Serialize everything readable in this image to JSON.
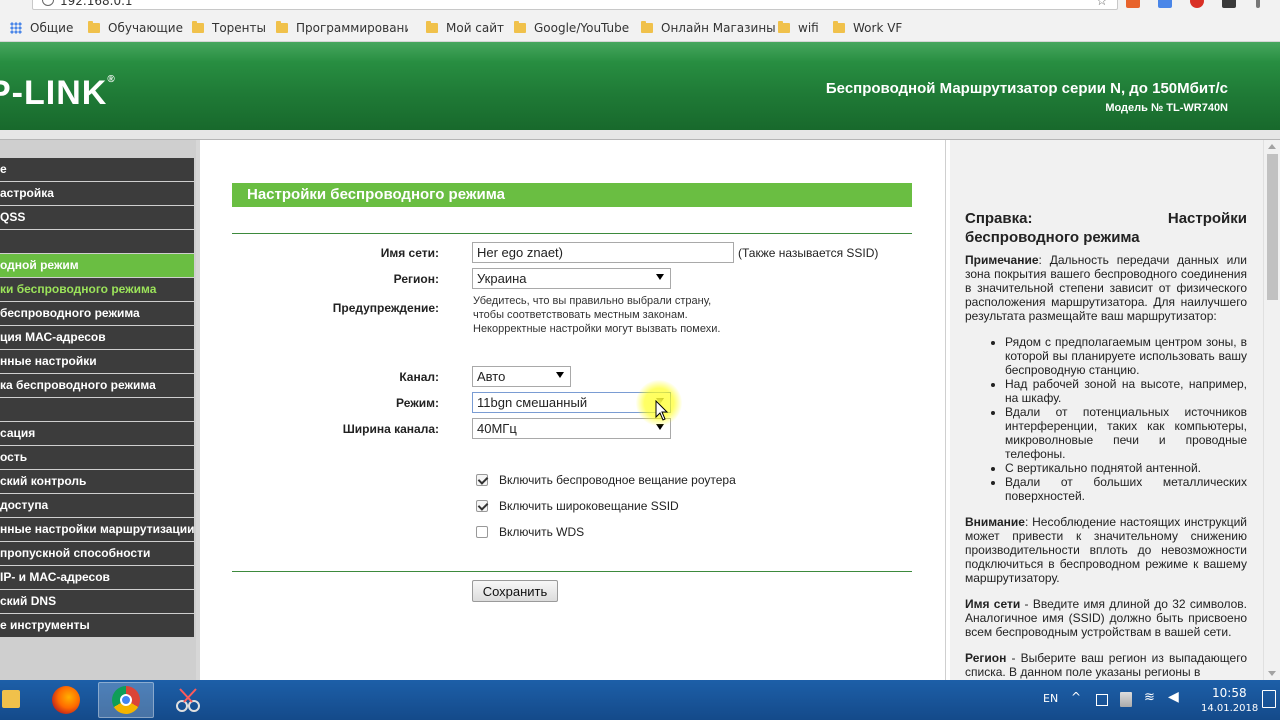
{
  "browser": {
    "address": "192.168.0.1",
    "bookmarks": [
      "Общие",
      "Обучающие",
      "Торенты",
      "Программирование",
      "Мой сайт",
      "Google/YouTube",
      "Онлайн Магазины",
      "wifi",
      "Work VF"
    ]
  },
  "header": {
    "logo": "P-LINK",
    "product_line": "Беспроводной Маршрутизатор серии N, до 150Мбит/с",
    "model": "Модель № TL-WR740N"
  },
  "sidebar": {
    "items": [
      {
        "label": "е",
        "state": "normal"
      },
      {
        "label": "астройка",
        "state": "normal"
      },
      {
        "label": "QSS",
        "state": "normal"
      },
      {
        "label": "",
        "state": "normal"
      },
      {
        "label": "одной режим",
        "state": "active"
      },
      {
        "label": "ки беспроводного режима",
        "state": "sub-active"
      },
      {
        "label": "беспроводного режима",
        "state": "normal"
      },
      {
        "label": "ция МАС-адресов",
        "state": "normal"
      },
      {
        "label": "нные настройки",
        "state": "normal"
      },
      {
        "label": "ка беспроводного режима",
        "state": "normal"
      },
      {
        "label": "",
        "state": "normal"
      },
      {
        "label": "сация",
        "state": "normal"
      },
      {
        "label": "ость",
        "state": "normal"
      },
      {
        "label": "ский контроль",
        "state": "normal"
      },
      {
        "label": "доступа",
        "state": "normal"
      },
      {
        "label": "нные настройки маршрутизации",
        "state": "normal"
      },
      {
        "label": "пропускной способности",
        "state": "normal"
      },
      {
        "label": "IP- и МАС-адресов",
        "state": "normal"
      },
      {
        "label": "ский DNS",
        "state": "normal"
      },
      {
        "label": "е инструменты",
        "state": "normal"
      }
    ]
  },
  "main": {
    "title": "Настройки беспроводного режима",
    "ssid_label": "Имя сети:",
    "ssid_value": "Her ego znaet)",
    "ssid_hint": "(Также называется SSID)",
    "region_label": "Регион:",
    "region_value": "Украина",
    "warning_label": "Предупреждение:",
    "warning_lines": [
      "Убедитесь, что вы правильно выбрали страну,",
      "чтобы соответствовать местным законам.",
      "Некорректные настройки могут вызвать помехи."
    ],
    "channel_label": "Канал:",
    "channel_value": "Авто",
    "mode_label": "Режим:",
    "mode_value": "11bgn смешанный",
    "width_label": "Ширина канала:",
    "width_value": "40МГц",
    "checkboxes": [
      {
        "label": "Включить беспроводное вещание роутера",
        "checked": true
      },
      {
        "label": "Включить широковещание SSID",
        "checked": true
      },
      {
        "label": "Включить WDS",
        "checked": false
      }
    ],
    "save_label": "Сохранить"
  },
  "help": {
    "title_left": "Справка:",
    "title_right": "Настройки",
    "title_second": "беспроводного режима",
    "note_label": "Примечание",
    "note_text": ": Дальность передачи данных или зона покрытия вашего беспроводного соединения в значительной степени зависит от физического расположения маршрутизатора. Для наилучшего результата размещайте ваш маршрутизатор:",
    "bullets": [
      "Рядом с предполагаемым центром зоны, в которой вы планируете использовать вашу беспроводную станцию.",
      "Над рабочей зоной на высоте, например, на шкафу.",
      "Вдали от потенциальных источников интерференции, таких как компьютеры, микроволновые печи и проводные телефоны.",
      "С вертикально поднятой антенной.",
      "Вдали от больших металлических поверхностей."
    ],
    "warning_label": "Внимание",
    "warning_text": ": Несоблюдение настоящих инструкций может привести к значительному снижению производительности вплоть до невозможности подключиться в беспроводном режиме к вашему маршрутизатору.",
    "ssid_label": "Имя сети",
    "ssid_text": " - Введите имя длиной до 32 символов. Аналогичное имя (SSID) должно быть присвоено всем беспроводным устройствам в вашей сети.",
    "region_label": "Регион",
    "region_text": " - Выберите ваш регион из выпадающего списка. В данном поле указаны регионы в"
  },
  "taskbar": {
    "lang": "EN",
    "time": "10:58",
    "date": "14.01.2018"
  },
  "colors": {
    "header_green": "#1f7a36",
    "accent_green": "#6abe42",
    "menu_dark": "#3c3c3c",
    "taskbar_blue": "#1d5fa8"
  }
}
